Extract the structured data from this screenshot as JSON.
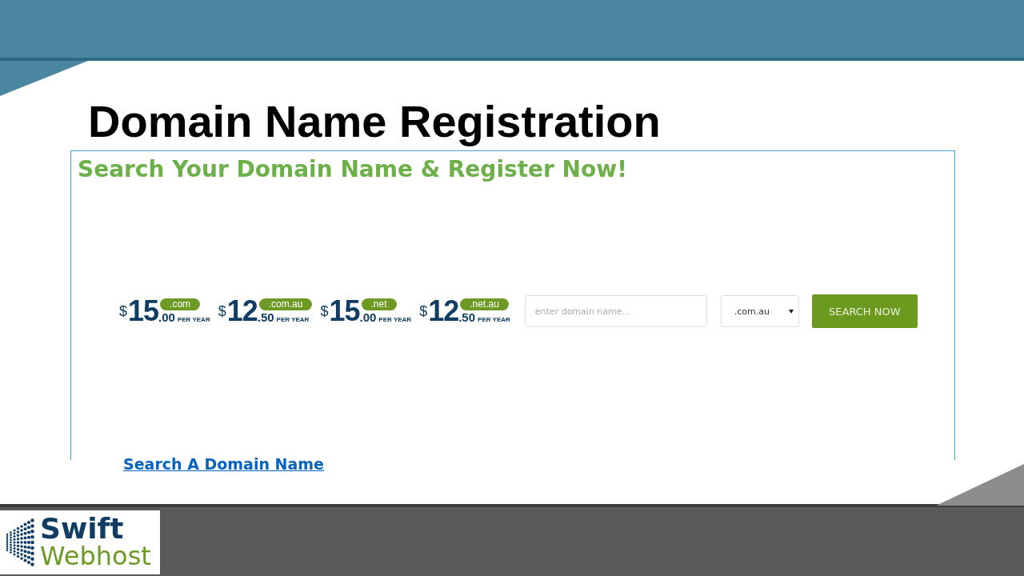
{
  "slide": {
    "title": "Domain Name Registration"
  },
  "web_screenshot": {
    "heading": "Search Your Domain Name & Register Now!",
    "prices": [
      {
        "currency": "$",
        "whole": "15",
        "cents": ".00",
        "period": "PER YEAR",
        "tld": ".com"
      },
      {
        "currency": "$",
        "whole": "12",
        "cents": ".50",
        "period": "PER YEAR",
        "tld": ".com.au"
      },
      {
        "currency": "$",
        "whole": "15",
        "cents": ".00",
        "period": "PER YEAR",
        "tld": ".net"
      },
      {
        "currency": "$",
        "whole": "12",
        "cents": ".50",
        "period": "PER YEAR",
        "tld": ".net.au"
      }
    ],
    "search": {
      "placeholder": "enter domain name..."
    },
    "extension_select": {
      "value": ".com.au"
    },
    "search_button": "SEARCH NOW"
  },
  "link": "Search A Domain Name",
  "logo": {
    "line_1": "Swift",
    "line_2": "Webhost"
  }
}
